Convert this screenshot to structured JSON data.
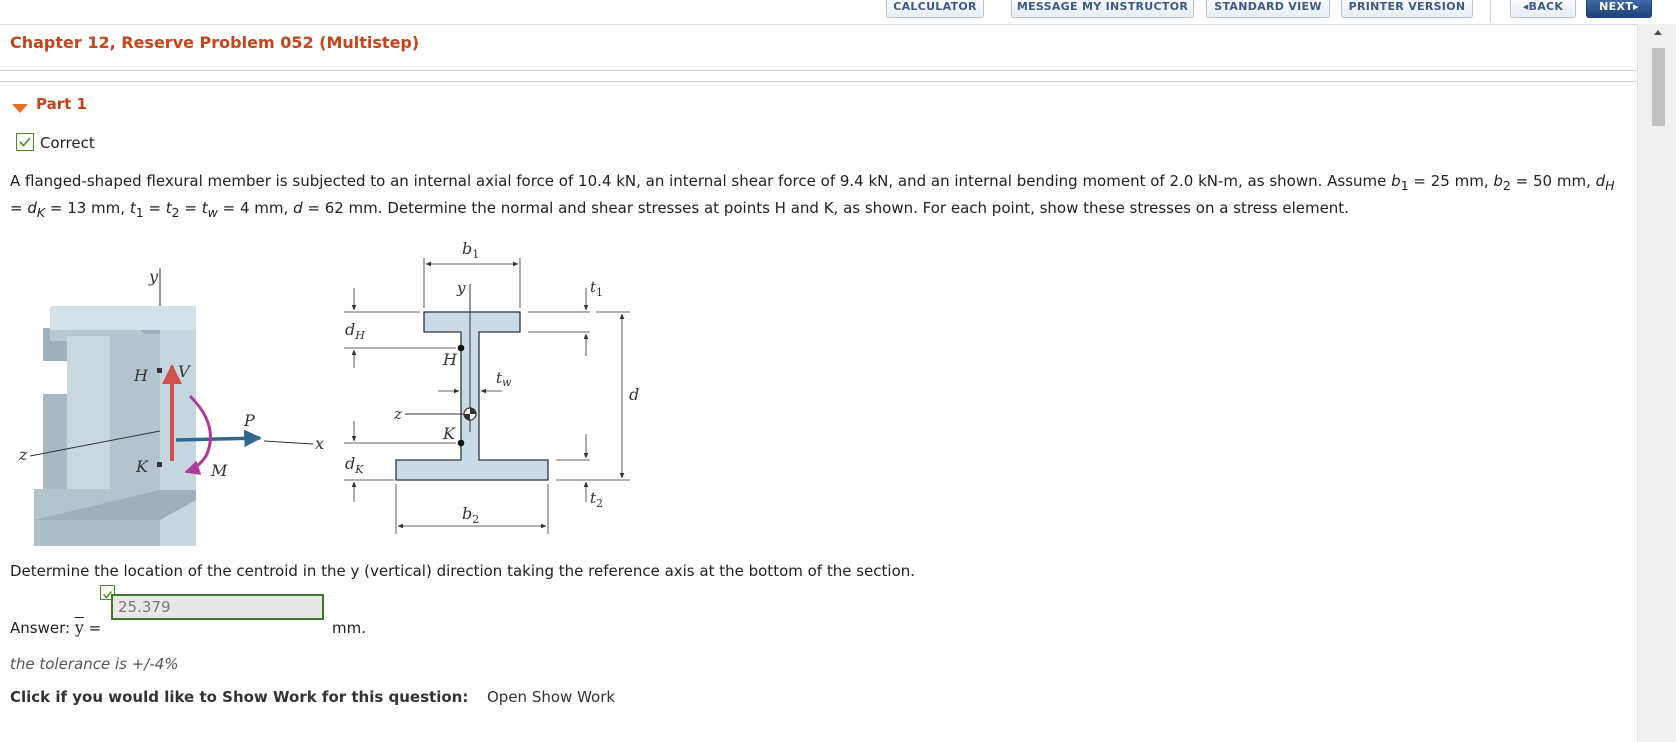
{
  "toolbar": {
    "calculator": "CALCULATOR",
    "message_instructor": "MESSAGE MY INSTRUCTOR",
    "standard_view": "STANDARD VIEW",
    "printer_version": "PRINTER VERSION",
    "back": "◂BACK",
    "next": "NEXT▸"
  },
  "chapter_title": "Chapter 12, Reserve Problem 052 (Multistep)",
  "part": {
    "label": "Part 1",
    "status": "Correct",
    "problem_prefix": "A flanged-shaped flexural member is subjected to an internal axial force of 10.4 kN, an internal shear force of 9.4 kN, and an internal bending moment of 2.0 kN-m, as shown. Assume ",
    "given_values": [
      "25 mm",
      "50 mm",
      "13 mm",
      "4 mm",
      "62 mm"
    ],
    "problem_suffix": ". Determine the normal and shear stresses at points H and K, as shown. For each point, show these stresses on a stress element.",
    "figure_labels": {
      "y": "y",
      "z": "z",
      "x": "x",
      "H": "H",
      "K": "K",
      "V": "V",
      "P": "P",
      "M": "M",
      "b1": "b",
      "b1_sub": "1",
      "b2": "b",
      "b2_sub": "2",
      "t1": "t",
      "t1_sub": "1",
      "t2": "t",
      "t2_sub": "2",
      "tw": "t",
      "tw_sub": "w",
      "dH": "d",
      "dH_sub": "H",
      "dK": "d",
      "dK_sub": "K",
      "d": "d"
    },
    "colors": {
      "section_fill": "#c8dbe6",
      "shear_arrow": "#d0504e",
      "axial_arrow": "#2e6891",
      "moment_arrow": "#b03a9a"
    },
    "question": "Determine the location of the centroid in the y (vertical) direction taking the reference axis at the bottom of the section.",
    "answer": {
      "label_prefix": "Answer: ",
      "symbol": "y",
      "equals": " =",
      "value": "25.379",
      "unit": "mm."
    },
    "tolerance": "the tolerance is +/-4%",
    "show_work_prompt": "Click if you would like to Show Work for this question:",
    "show_work_link": "Open Show Work"
  }
}
